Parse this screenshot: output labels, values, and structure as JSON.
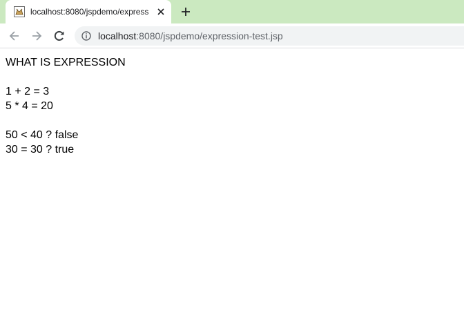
{
  "browser": {
    "tab_title": "localhost:8080/jspdemo/express",
    "url_host": "localhost",
    "url_rest": ":8080/jspdemo/expression-test.jsp",
    "colors": {
      "tabstrip": "#cbe9c0",
      "omnibox": "#f1f3f4"
    }
  },
  "page": {
    "heading": "WHAT IS EXPRESSION",
    "lines": [
      "1 + 2 = 3",
      "5 * 4 = 20",
      "50 < 40 ? false",
      "30 = 30 ? true"
    ]
  }
}
